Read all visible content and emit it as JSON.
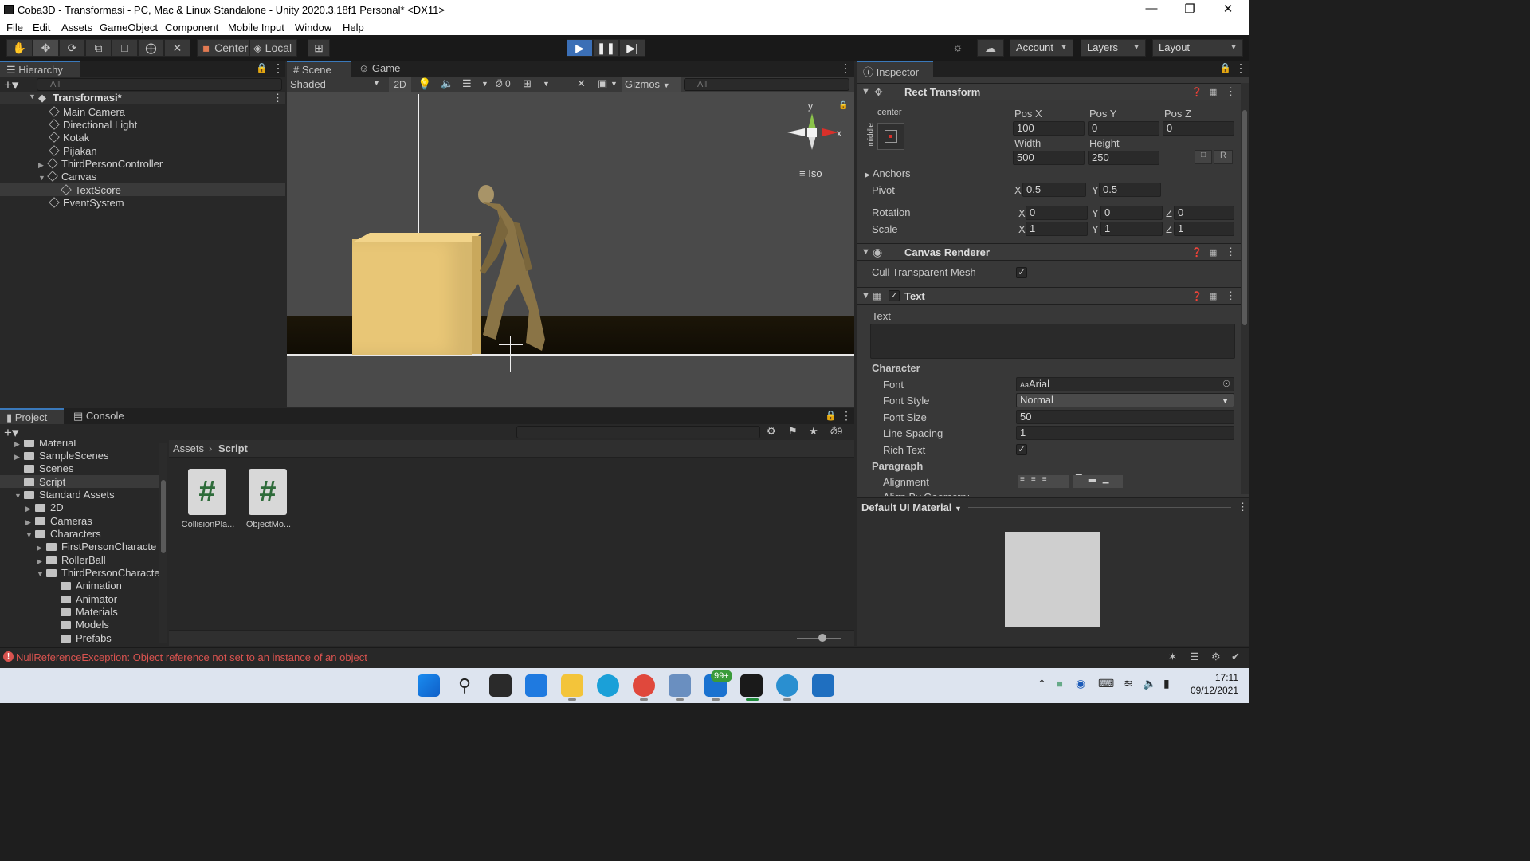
{
  "window": {
    "title": "Coba3D - Transformasi - PC, Mac & Linux Standalone - Unity 2020.3.18f1 Personal* <DX11>"
  },
  "menu": [
    "File",
    "Edit",
    "Assets",
    "GameObject",
    "Component",
    "Mobile Input",
    "Window",
    "Help"
  ],
  "toolbar": {
    "pivot_center": "Center",
    "pivot_local": "Local",
    "account": "Account",
    "layers": "Layers",
    "layout": "Layout"
  },
  "hierarchy": {
    "tab": "Hierarchy",
    "search_placeholder": "All",
    "scene": "Transformasi*",
    "items": [
      {
        "label": "Main Camera"
      },
      {
        "label": "Directional Light"
      },
      {
        "label": "Kotak"
      },
      {
        "label": "Pijakan"
      },
      {
        "label": "ThirdPersonController"
      },
      {
        "label": "Canvas"
      },
      {
        "label": "TextScore"
      },
      {
        "label": "EventSystem"
      }
    ]
  },
  "scene": {
    "tab_scene": "Scene",
    "tab_game": "Game",
    "shading": "Shaded",
    "mode2d": "2D",
    "hidden_count": "0",
    "gizmos": "Gizmos",
    "search_placeholder": "All",
    "gizmo_y": "y",
    "gizmo_x": "x",
    "iso": "Iso"
  },
  "project": {
    "tab_project": "Project",
    "tab_console": "Console",
    "hidden_count": "9",
    "tree": [
      "Material",
      "SampleScenes",
      "Scenes",
      "Script",
      "Standard Assets",
      "2D",
      "Cameras",
      "Characters",
      "FirstPersonCharacte",
      "RollerBall",
      "ThirdPersonCharacte",
      "Animation",
      "Animator",
      "Materials",
      "Models",
      "Prefabs"
    ],
    "breadcrumb_root": "Assets",
    "breadcrumb_current": "Script",
    "assets": [
      {
        "label": "CollisionPla...",
        "glyph": "#"
      },
      {
        "label": "ObjectMo...",
        "glyph": "#"
      }
    ]
  },
  "inspector": {
    "tab": "Inspector",
    "rect_transform": {
      "title": "Rect Transform",
      "anchor_h": "center",
      "anchor_v": "middle",
      "pos_x_label": "Pos X",
      "pos_y_label": "Pos Y",
      "pos_z_label": "Pos Z",
      "pos_x": "100",
      "pos_y": "0",
      "pos_z": "0",
      "width_label": "Width",
      "height_label": "Height",
      "width": "500",
      "height": "250",
      "r_btn": "R",
      "anchors": "Anchors",
      "pivot": "Pivot",
      "pivot_x": "0.5",
      "pivot_y": "0.5",
      "rotation": "Rotation",
      "rot_x": "0",
      "rot_y": "0",
      "rot_z": "0",
      "scale": "Scale",
      "scale_x": "1",
      "scale_y": "1",
      "scale_z": "1",
      "x": "X",
      "y": "Y",
      "z": "Z"
    },
    "canvas_renderer": {
      "title": "Canvas Renderer",
      "cull_label": "Cull Transparent Mesh"
    },
    "text": {
      "title": "Text",
      "text_label": "Text",
      "text_value": "",
      "character": "Character",
      "font_label": "Font",
      "font": "Arial",
      "font_style_label": "Font Style",
      "font_style": "Normal",
      "font_size_label": "Font Size",
      "font_size": "50",
      "line_spacing_label": "Line Spacing",
      "line_spacing": "1",
      "rich_text_label": "Rich Text",
      "paragraph": "Paragraph",
      "alignment_label": "Alignment",
      "align_by_geometry": "Align By Geometry"
    },
    "material": "Default UI Material"
  },
  "status": {
    "error": "NullReferenceException: Object reference not set to an instance of an object"
  },
  "taskbar": {
    "mail_badge": "99+",
    "time": "17:11",
    "date": "09/12/2021"
  },
  "colors": {
    "accent": "#3a79bb",
    "error": "#d9534f",
    "box": "#e8c676",
    "play_active": "#3b6fb6"
  }
}
